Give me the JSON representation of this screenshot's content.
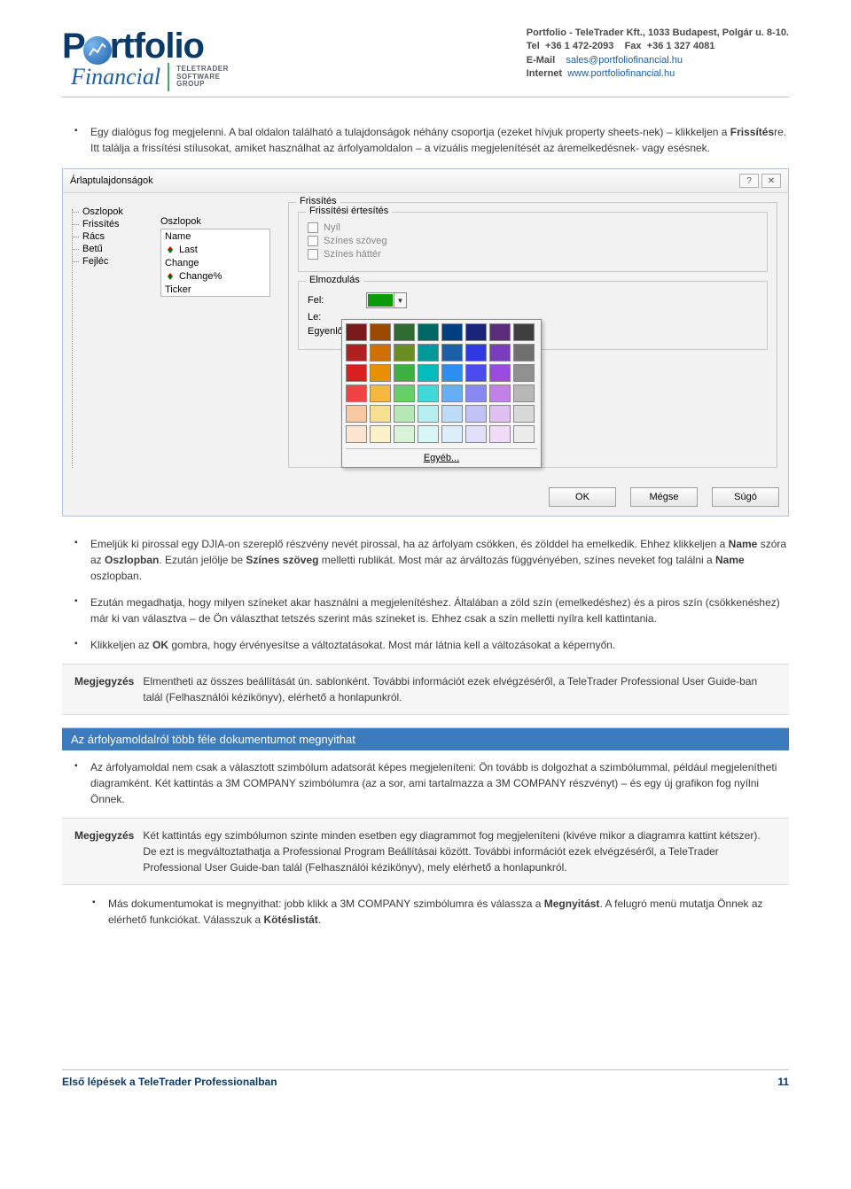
{
  "header": {
    "logo": {
      "word1_prefix": "P",
      "word1_rest": "rtfolio",
      "word2": "Financial",
      "tt1": "TELETRADER",
      "tt2": "SOFTWARE",
      "tt3": "GROUP"
    },
    "company_line1": "Portfolio - TeleTrader Kft., 1033 Budapest, Polgár u. 8-10.",
    "company_line2_label": "Tel",
    "company_line2_tel": "+36 1 472-2093",
    "company_line2_faxlabel": "Fax",
    "company_line2_fax": "+36 1 327 4081",
    "company_line3_label": "E-Mail",
    "company_line3_value": "sales@portfoliofinancial.hu",
    "company_line4_label": "Internet",
    "company_line4_value": "www.portfoliofinancial.hu"
  },
  "bullets_top": {
    "b1_a": "Egy dialógus fog megjelenni. A bal oldalon található a tulajdonságok néhány csoportja (ezeket hívjuk property sheets-nek) – klikkeljen a ",
    "b1_bold1": "Frissítés",
    "b1_b": "re. Itt találja a frissítési stílusokat, amiket használhat az árfolyamoldalon – a vizuális megjelenítését az áremelkedésnek- vagy esésnek."
  },
  "dialog": {
    "title": "Árlaptulajdonságok",
    "help_icon": "?",
    "close_icon": "✕",
    "tree": [
      "Oszlopok",
      "Frissítés",
      "Rács",
      "Betű",
      "Fejléc"
    ],
    "cols_label": "Oszlopok",
    "cols": [
      "Name",
      "Last",
      "Change",
      "Change%",
      "Ticker"
    ],
    "outer_legend": "Frissítés",
    "notify_legend": "Frissítési értesítés",
    "chk1": "Nyíl",
    "chk2": "Színes szöveg",
    "chk3": "Színes háttér",
    "move_legend": "Elmozdulás",
    "row_up": "Fel:",
    "row_down": "Le:",
    "row_eq": "Egyenlő:",
    "up_color": "#0a9a0a",
    "palette_other": "Egyéb...",
    "palette": [
      "#7a1a1a",
      "#9c4a00",
      "#2e6b2e",
      "#006666",
      "#004080",
      "#1a237a",
      "#5a2e7a",
      "#404040",
      "#b02020",
      "#d07000",
      "#6b8e23",
      "#009999",
      "#1a5fa8",
      "#2e3ae0",
      "#7a3dc0",
      "#707070",
      "#d82020",
      "#e89000",
      "#3cb043",
      "#00bcbc",
      "#2e8df0",
      "#4a4af0",
      "#9a4ae0",
      "#909090",
      "#f04444",
      "#f5b740",
      "#66d066",
      "#40d8d8",
      "#66aef6",
      "#8888f2",
      "#c080e8",
      "#b8b8b8",
      "#f8c8a0",
      "#f6e090",
      "#b4e8b4",
      "#b4eeee",
      "#bcdcf8",
      "#c2c2f6",
      "#e0c0f2",
      "#d8d8d8",
      "#fde4d0",
      "#fbf2c8",
      "#d8f4d8",
      "#d8f6f6",
      "#dceefa",
      "#e0e0fa",
      "#f0dcf8",
      "#ececec"
    ],
    "btn_ok": "OK",
    "btn_cancel": "Mégse",
    "btn_help": "Súgó"
  },
  "bullets_mid": {
    "b2_a": "Emeljük ki pirossal egy DJIA-on szereplő részvény nevét pirossal, ha az árfolyam csökken, és zölddel ha emelkedik. Ehhez klikkeljen a ",
    "b2_bold1": "Name",
    "b2_b": " szóra az ",
    "b2_bold2": "Oszlopban",
    "b2_c": ". Ezután jelölje be ",
    "b2_bold3": "Színes szöveg",
    "b2_d": " melletti rublikát. Most már az árváltozás függvényében, színes neveket fog találni a ",
    "b2_bold4": "Name",
    "b2_e": " oszlopban.",
    "b3": "Ezután megadhatja, hogy milyen színeket akar használni a megjelenítéshez. Általában a zöld szín (emelkedéshez) és a piros szín (csökkenéshez) már ki van választva – de Ön választhat tetszés szerint más színeket is. Ehhez csak a szín melletti nyílra kell kattintania.",
    "b4_a": "Klikkeljen az ",
    "b4_bold1": "OK",
    "b4_b": " gombra, hogy érvényesítse a változtatásokat. Most már látnia kell a változásokat a képernyőn."
  },
  "note1": {
    "label": "Megjegyzés",
    "text": "Elmentheti az összes beállítását ún. sablonként. További információt ezek elvégzéséről, a TeleTrader Professional User Guide-ban talál (Felhasználói kézikönyv), elérhető a honlapunkról."
  },
  "section_bar": "Az árfolyamoldalról több féle dokumentumot megnyithat",
  "bullet_after_bar": "Az árfolyamoldal nem csak a választott szimbólum adatsorát képes megjeleníteni: Ön tovább is dolgozhat a szimbólummal, például megjelenítheti diagramként. Két kattintás a 3M COMPANY szimbólumra (az a sor, ami tartalmazza a 3M COMPANY részvényt) – és egy új grafikon fog nyílni Önnek.",
  "note2": {
    "label": "Megjegyzés",
    "text": "Két kattintás egy szimbólumon szinte minden esetben egy diagrammot fog megjeleníteni (kivéve mikor a diagramra kattint kétszer). De ezt is megváltoztathatja a Professional Program Beállításai között. További információt ezek elvégzéséről, a TeleTrader Professional User Guide-ban talál (Felhasználói kézikönyv), mely elérhető a honlapunkról."
  },
  "bullet_last": {
    "a": "Más dokumentumokat is megnyithat: jobb klikk a 3M COMPANY szimbólumra és válassza a ",
    "bold1": "Megnyitást",
    "b": ". A felugró menü mutatja Önnek az elérhető funkciókat. Válasszuk a ",
    "bold2": "Kötéslistát",
    "c": "."
  },
  "footer": {
    "title": "Első lépések a TeleTrader Professionalban",
    "page": "11"
  }
}
